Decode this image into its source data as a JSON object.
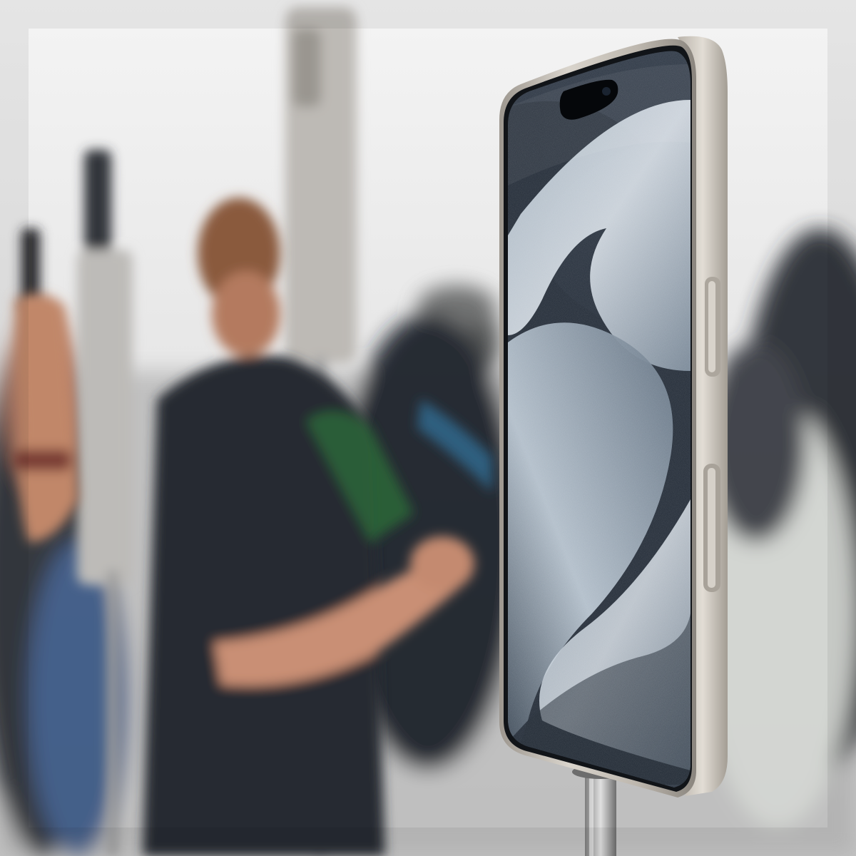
{
  "scene": {
    "subject": "smartphone-on-display-stand",
    "palette": {
      "background_top": "#f3f3f3",
      "background_mid": "#dcdcdc",
      "crowd_dark": "#2a2f36",
      "crowd_hair": "#8a5a3c",
      "skin": "#c98f74",
      "titanium_frame": "#c9c4bc",
      "frame_shadow": "#8f8a83",
      "screen_dark": "#1b2330",
      "screen_wave_light": "#c9d4de",
      "screen_wave_mid": "#6f7f8f",
      "stand_metal": "#b8b8b8",
      "lanyard_blue": "#2f5f7f"
    }
  }
}
